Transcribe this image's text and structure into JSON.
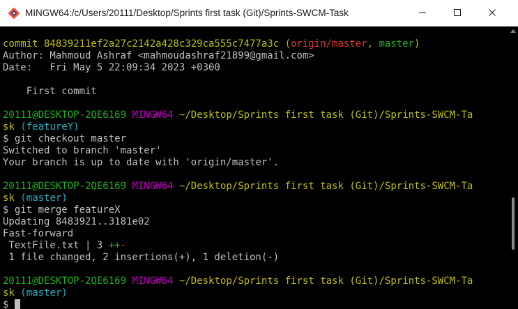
{
  "window": {
    "title": "MINGW64:/c/Users/20111/Desktop/Sprints first task (Git)/Sprints-SWCM-Task",
    "icon": "git-bash-icon",
    "controls": {
      "minimize": "minimize-icon",
      "maximize": "maximize-icon",
      "close": "close-icon"
    }
  },
  "terminal": {
    "commit_line": {
      "prefix": "commit 84839211ef2a27c2142a428c329ca555c7477a3c",
      "open": " (",
      "remote": "origin/master",
      "sep": ", ",
      "local": "master",
      "close": ")"
    },
    "author_line": "Author: Mahmoud Ashraf <mahmoudashraf21899@gmail.com>",
    "date_line": "Date:   Fri May 5 22:09:34 2023 +0300",
    "message_line": "    First commit",
    "prompt1": {
      "user": "20111@DESKTOP-2QE6169",
      "env": "MINGW64",
      "path": "~/Desktop/Sprints first task (Git)/Sprints-SWCM-Ta",
      "path_wrap": "sk",
      "branch": "(featureY)"
    },
    "cmd1": "$ git checkout master",
    "out1_a": "Switched to branch 'master'",
    "out1_b": "Your branch is up to date with 'origin/master'.",
    "prompt2": {
      "user": "20111@DESKTOP-2QE6169",
      "env": "MINGW64",
      "path": "~/Desktop/Sprints first task (Git)/Sprints-SWCM-Ta",
      "path_wrap": "sk",
      "branch": "(master)"
    },
    "cmd2": "$ git merge featureX",
    "out2_a": "Updating 8483921..3181e02",
    "out2_b": "Fast-forward",
    "diffstat": {
      "file": " TextFile.txt | 3 ",
      "plus": "++",
      "minus": "-"
    },
    "summary": " 1 file changed, 2 insertions(+), 1 deletion(-)",
    "prompt3": {
      "user": "20111@DESKTOP-2QE6169",
      "env": "MINGW64",
      "path": "~/Desktop/Sprints first task (Git)/Sprints-SWCM-Ta",
      "path_wrap": "sk",
      "branch": "(master)"
    },
    "final_prompt": "$ "
  },
  "colors": {
    "background": "#000000",
    "text": "#bfbfbf",
    "yellow": "#bfbf00",
    "red": "#d9352b",
    "green": "#18b218",
    "magenta": "#bf00bf",
    "cyan": "#19b2bf"
  }
}
